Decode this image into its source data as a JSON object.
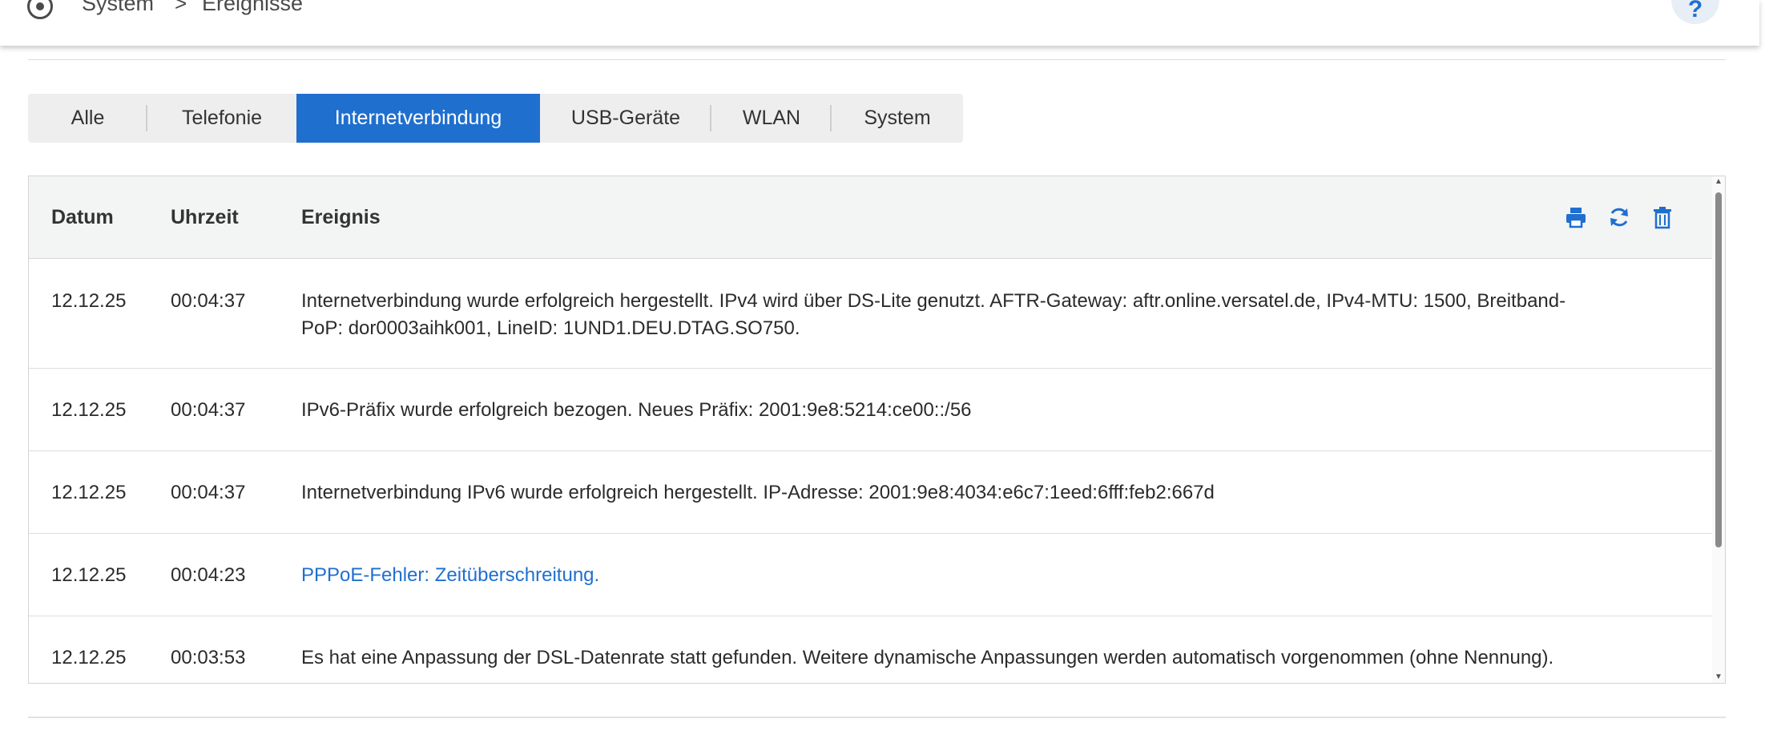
{
  "breadcrumb": {
    "icon": "settings-circle-icon",
    "items": [
      "System",
      "Ereignisse"
    ],
    "separator": ">"
  },
  "help": {
    "label": "?"
  },
  "colors": {
    "accent": "#1f6fcf",
    "link": "#1f6fcf"
  },
  "tabs": [
    {
      "label": "Alle",
      "active": false
    },
    {
      "label": "Telefonie",
      "active": false
    },
    {
      "label": "Internetverbindung",
      "active": true
    },
    {
      "label": "USB-Geräte",
      "active": false
    },
    {
      "label": "WLAN",
      "active": false
    },
    {
      "label": "System",
      "active": false
    }
  ],
  "table": {
    "columns": [
      "Datum",
      "Uhrzeit",
      "Ereignis"
    ],
    "actions": [
      "print-icon",
      "refresh-icon",
      "trash-icon"
    ],
    "rows": [
      {
        "date": "12.12.25",
        "time": "00:04:37",
        "event_line1": "Internetverbindung wurde erfolgreich hergestellt. IPv4 wird über DS-Lite genutzt. AFTR-Gateway: aftr.online.versatel.de, IPv4-MTU: 1500, Breitband-",
        "event_line2": "PoP: dor0003aihk001, LineID: 1UND1.DEU.DTAG.SO750.",
        "link": false
      },
      {
        "date": "12.12.25",
        "time": "00:04:37",
        "event": "IPv6-Präfix wurde erfolgreich bezogen. Neues Präfix: 2001:9e8:5214:ce00::/56",
        "link": false
      },
      {
        "date": "12.12.25",
        "time": "00:04:37",
        "event": "Internetverbindung IPv6 wurde erfolgreich hergestellt. IP-Adresse: 2001:9e8:4034:e6c7:1eed:6fff:feb2:667d",
        "link": false
      },
      {
        "date": "12.12.25",
        "time": "00:04:23",
        "event": "PPPoE-Fehler: Zeitüberschreitung.",
        "link": true
      },
      {
        "date": "12.12.25",
        "time": "00:03:53",
        "event": "Es hat eine Anpassung der DSL-Datenrate statt gefunden. Weitere dynamische Anpassungen werden automatisch vorgenommen (ohne Nennung).",
        "link": false
      }
    ]
  }
}
